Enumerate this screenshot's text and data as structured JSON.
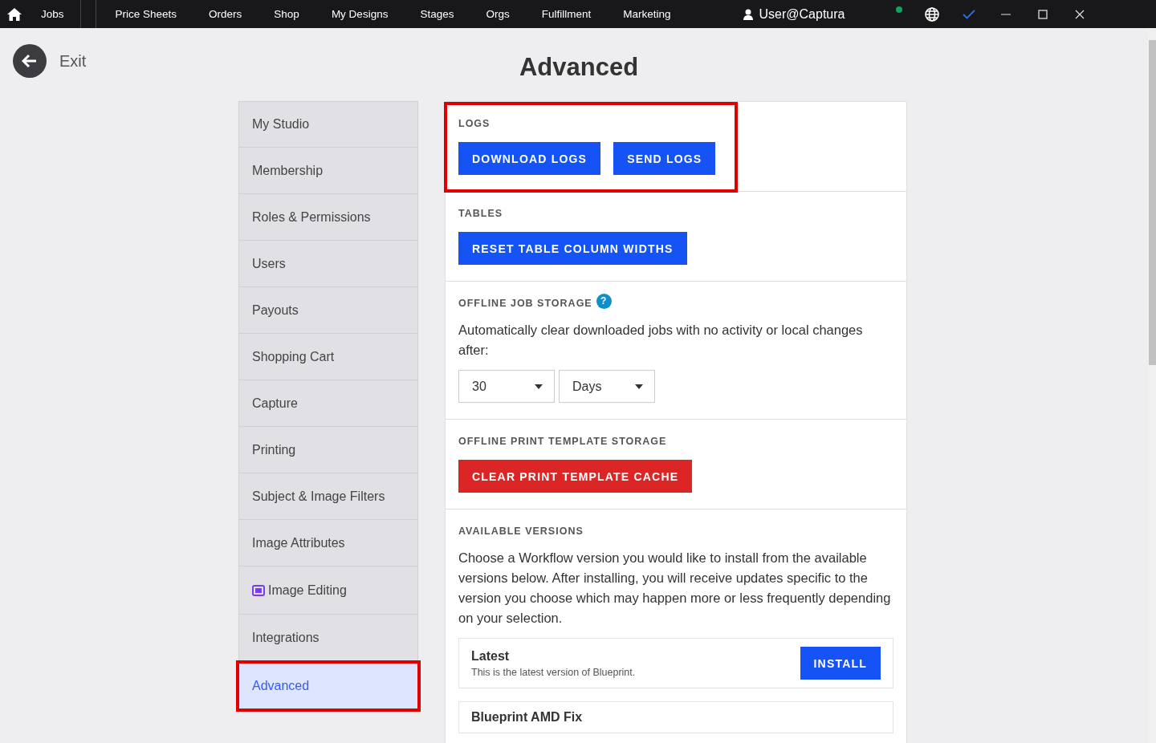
{
  "topbar": {
    "nav": [
      {
        "label": "Jobs"
      },
      {
        "label": "Price Sheets"
      },
      {
        "label": "Orders"
      },
      {
        "label": "Shop"
      },
      {
        "label": "My Designs"
      },
      {
        "label": "Stages"
      },
      {
        "label": "Orgs"
      },
      {
        "label": "Fulfillment"
      },
      {
        "label": "Marketing"
      }
    ],
    "user": "User@Captura",
    "online": true
  },
  "exit": "Exit",
  "title": "Advanced",
  "sidebar": {
    "items": [
      {
        "label": "My Studio",
        "selected": false,
        "ai": false,
        "highlighted": false
      },
      {
        "label": "Membership",
        "selected": false,
        "ai": false,
        "highlighted": false
      },
      {
        "label": "Roles & Permissions",
        "selected": false,
        "ai": false,
        "highlighted": false
      },
      {
        "label": "Users",
        "selected": false,
        "ai": false,
        "highlighted": false
      },
      {
        "label": "Payouts",
        "selected": false,
        "ai": false,
        "highlighted": false
      },
      {
        "label": "Shopping Cart",
        "selected": false,
        "ai": false,
        "highlighted": false
      },
      {
        "label": "Capture",
        "selected": false,
        "ai": false,
        "highlighted": false
      },
      {
        "label": "Printing",
        "selected": false,
        "ai": false,
        "highlighted": false
      },
      {
        "label": "Subject & Image Filters",
        "selected": false,
        "ai": false,
        "highlighted": false
      },
      {
        "label": "Image Attributes",
        "selected": false,
        "ai": false,
        "highlighted": false
      },
      {
        "label": "Image Editing",
        "selected": false,
        "ai": true,
        "highlighted": false
      },
      {
        "label": "Integrations",
        "selected": false,
        "ai": false,
        "highlighted": false
      },
      {
        "label": "Advanced",
        "selected": true,
        "ai": false,
        "highlighted": true
      }
    ]
  },
  "sections": [
    {
      "heading": "LOGS",
      "highlighted": true,
      "buttons": [
        {
          "label": "DOWNLOAD LOGS",
          "kind": "primary"
        },
        {
          "label": "SEND LOGS",
          "kind": "primary"
        }
      ]
    },
    {
      "heading": "TABLES",
      "highlighted": false,
      "buttons": [
        {
          "label": "RESET TABLE COLUMN WIDTHS",
          "kind": "primary"
        }
      ]
    },
    {
      "heading": "OFFLINE JOB STORAGE",
      "help": "?",
      "highlighted": false,
      "text": "Automatically clear downloaded jobs with no activity or local changes after:",
      "selects": [
        {
          "value": "30"
        },
        {
          "value": "Days"
        }
      ]
    },
    {
      "heading": "OFFLINE PRINT TEMPLATE STORAGE",
      "highlighted": false,
      "buttons": [
        {
          "label": "CLEAR PRINT TEMPLATE CACHE",
          "kind": "danger"
        }
      ]
    },
    {
      "heading": "AVAILABLE VERSIONS",
      "highlighted": false,
      "text": "Choose a Workflow version you would like to install from the available versions below. After installing, you will receive updates specific to the version you choose which may happen more or less frequently depending on your selection.",
      "versions": [
        {
          "name": "Latest",
          "description": "This is the latest version of Blueprint.",
          "button": "INSTALL"
        },
        {
          "name": "Blueprint AMD Fix"
        }
      ]
    }
  ]
}
